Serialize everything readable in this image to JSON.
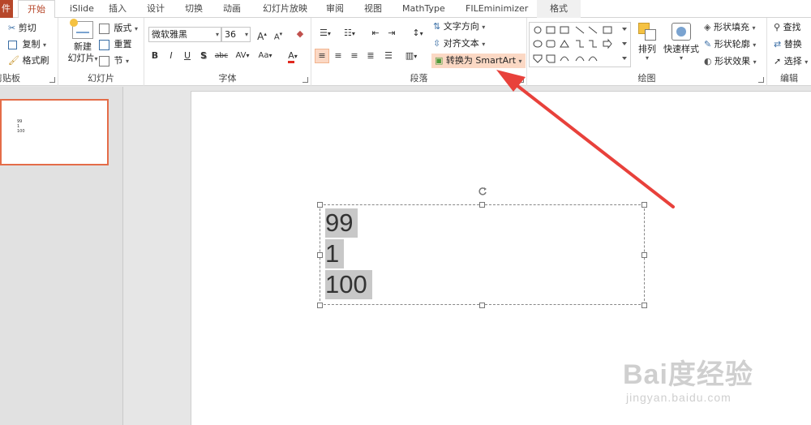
{
  "tabs": {
    "file": "件",
    "home": "开始",
    "islide": "iSlide",
    "insert": "插入",
    "design": "设计",
    "transitions": "切换",
    "animations": "动画",
    "slideshow": "幻灯片放映",
    "review": "审阅",
    "view": "视图",
    "mathtype": "MathType",
    "fileminimizer": "FILEminimizer",
    "format": "格式"
  },
  "clipboard": {
    "cut": "剪切",
    "copy": "复制",
    "format_painter": "格式刷",
    "label": "剪贴板"
  },
  "slides": {
    "new_slide_line1": "新建",
    "new_slide_line2": "幻灯片",
    "layout": "版式",
    "reset": "重置",
    "section": "节",
    "label": "幻灯片"
  },
  "font": {
    "name": "微软雅黑",
    "size": "36",
    "bold": "B",
    "italic": "I",
    "underline": "U",
    "shadow": "S",
    "strikethrough": "abc",
    "spacing": "AV",
    "case": "Aa",
    "color_letter": "A",
    "grow": "A",
    "shrink": "A",
    "label": "字体"
  },
  "paragraph": {
    "text_direction": "文字方向",
    "align_text": "对齐文本",
    "convert_smartart": "转换为 SmartArt",
    "label": "段落"
  },
  "drawing": {
    "arrange": "排列",
    "quick_styles": "快速样式",
    "shape_fill": "形状填充",
    "shape_outline": "形状轮廓",
    "shape_effects": "形状效果",
    "label": "绘图"
  },
  "editing": {
    "find": "查找",
    "replace": "替换",
    "select": "选择",
    "label": "编辑"
  },
  "thumbnail": {
    "lines": [
      "99",
      "1",
      "100"
    ]
  },
  "textbox": {
    "lines": [
      "99",
      "1",
      "100"
    ]
  },
  "watermark": {
    "brand": "Bai度经验",
    "url": "jingyan.baidu.com"
  },
  "colors": {
    "accent": "#b7472a",
    "arrow": "#e8413b",
    "highlight": "#fbd8c4"
  }
}
